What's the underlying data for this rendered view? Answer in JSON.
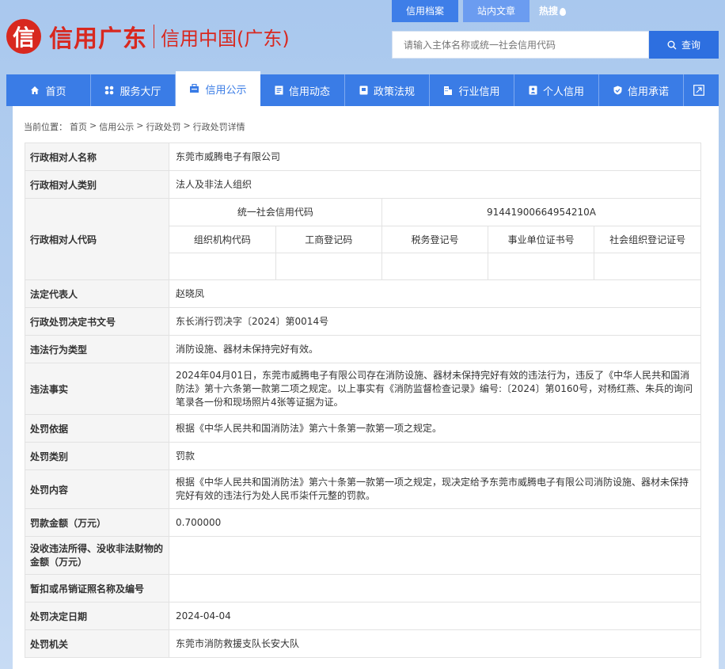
{
  "header": {
    "logo_char": "信",
    "logo_script": "信用广东",
    "site_name": "信用中国(广东)",
    "top_tabs": [
      "信用档案",
      "站内文章"
    ],
    "hot_label": "热搜",
    "search_placeholder": "请输入主体名称或统一社会信用代码",
    "search_button": "查询"
  },
  "nav": [
    {
      "label": "首页",
      "icon": "home-icon"
    },
    {
      "label": "服务大厅",
      "icon": "grid-icon"
    },
    {
      "label": "信用公示",
      "icon": "announce-icon",
      "active": true
    },
    {
      "label": "信用动态",
      "icon": "news-icon"
    },
    {
      "label": "政策法规",
      "icon": "book-icon"
    },
    {
      "label": "行业信用",
      "icon": "building-icon"
    },
    {
      "label": "个人信用",
      "icon": "person-icon"
    },
    {
      "label": "信用承诺",
      "icon": "shield-icon"
    }
  ],
  "breadcrumb": {
    "prefix": "当前位置：",
    "items": [
      "首页",
      "信用公示",
      "行政处罚",
      "行政处罚详情"
    ],
    "separator": ">"
  },
  "detail": {
    "name": {
      "label": "行政相对人名称",
      "value": "东莞市威腾电子有限公司"
    },
    "category": {
      "label": "行政相对人类别",
      "value": "法人及非法人组织"
    },
    "code": {
      "label": "行政相对人代码",
      "uscc_label": "统一社会信用代码",
      "uscc_value": "91441900664954210A",
      "sub_labels": [
        "组织机构代码",
        "工商登记码",
        "税务登记号",
        "事业单位证书号",
        "社会组织登记证号"
      ],
      "sub_values": [
        "",
        "",
        "",
        "",
        ""
      ]
    },
    "legal_rep": {
      "label": "法定代表人",
      "value": "赵晓凤"
    },
    "doc_no": {
      "label": "行政处罚决定书文号",
      "value": "东长消行罚决字〔2024〕第0014号"
    },
    "violation_type": {
      "label": "违法行为类型",
      "value": "消防设施、器材未保持完好有效。"
    },
    "facts": {
      "label": "违法事实",
      "value": "2024年04月01日，东莞市威腾电子有限公司存在消防设施、器材未保持完好有效的违法行为，违反了《中华人民共和国消防法》第十六条第一款第二项之规定。以上事实有《消防监督检查记录》编号:〔2024〕第0160号，对杨红燕、朱兵的询问笔录各一份和现场照片4张等证据为证。"
    },
    "basis": {
      "label": "处罚依据",
      "value": "根据《中华人民共和国消防法》第六十条第一款第一项之规定。"
    },
    "penalty_type": {
      "label": "处罚类别",
      "value": "罚款"
    },
    "content": {
      "label": "处罚内容",
      "value": "根据《中华人民共和国消防法》第六十条第一款第一项之规定，现决定给予东莞市威腾电子有限公司消防设施、器材未保持完好有效的违法行为处人民币柒仟元整的罚款。"
    },
    "amount": {
      "label": "罚款金额（万元）",
      "value": "0.700000"
    },
    "confiscated": {
      "label": "没收违法所得、没收非法财物的金额（万元）",
      "value": ""
    },
    "license": {
      "label": "暂扣或吊销证照名称及编号",
      "value": ""
    },
    "date": {
      "label": "处罚决定日期",
      "value": "2024-04-04"
    },
    "authority": {
      "label": "处罚机关",
      "value": "东莞市消防救援支队长安大队"
    }
  },
  "colors": {
    "brand_red": "#d8281f",
    "nav_blue": "#3a7ce6",
    "search_blue": "#2d6fe0"
  }
}
